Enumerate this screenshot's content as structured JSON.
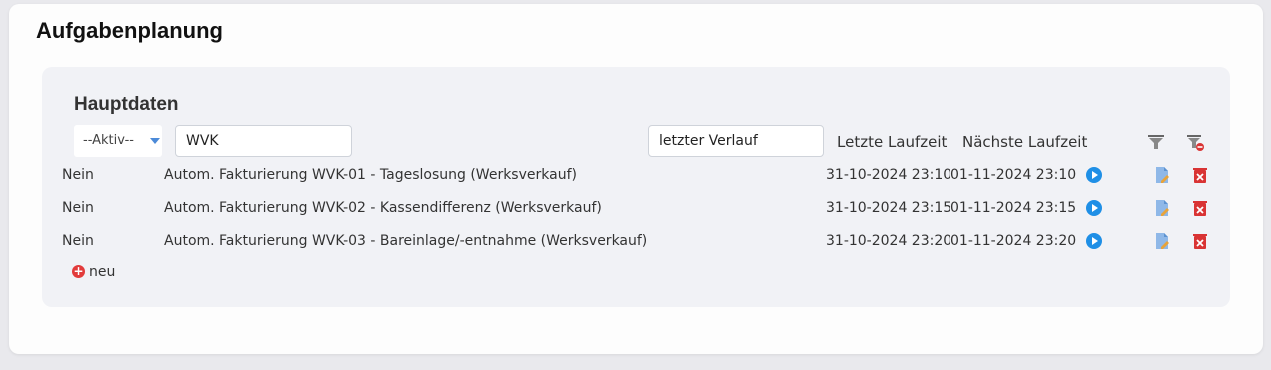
{
  "page": {
    "title": "Aufgabenplanung"
  },
  "section": {
    "title": "Hauptdaten"
  },
  "filters": {
    "active_select": "--Aktiv--",
    "text_filter": "WVK",
    "history_filter": "letzter Verlauf"
  },
  "columns": {
    "last_run": "Letzte Laufzeit",
    "next_run": "Nächste Laufzeit"
  },
  "rows": [
    {
      "active": "Nein",
      "name": "Autom. Fakturierung WVK-01 - Tageslosung (Werksverkauf)",
      "last": "31-10-2024 23:10",
      "next": "01-11-2024 23:10"
    },
    {
      "active": "Nein",
      "name": "Autom. Fakturierung WVK-02 - Kassendifferenz (Werksverkauf)",
      "last": "31-10-2024 23:15",
      "next": "01-11-2024 23:15"
    },
    {
      "active": "Nein",
      "name": "Autom. Fakturierung WVK-03 - Bareinlage/-entnahme (Werksverkauf)",
      "last": "31-10-2024 23:20",
      "next": "01-11-2024 23:20"
    }
  ],
  "new_link": "neu",
  "colors": {
    "accent": "#1f8fe6",
    "danger": "#d93434",
    "panel": "#f1f2f6"
  },
  "icons": [
    "filter-icon",
    "filter-clear-icon",
    "run-icon",
    "edit-icon",
    "delete-icon",
    "add-icon"
  ]
}
